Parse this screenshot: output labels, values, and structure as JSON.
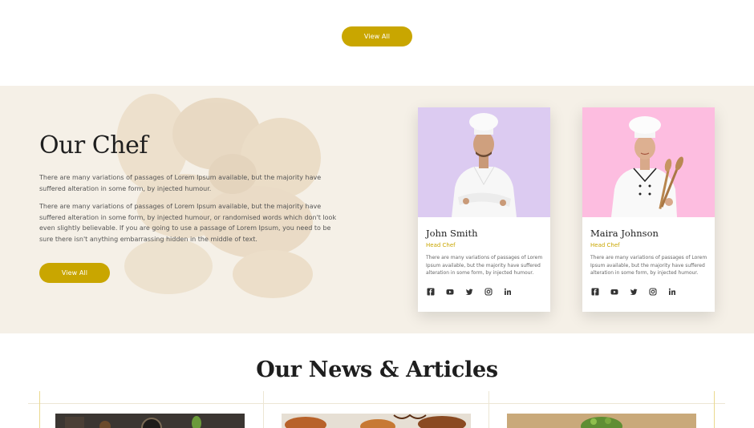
{
  "top": {
    "view_all_label": "View All"
  },
  "chef_section": {
    "title": "Our Chef",
    "paragraph_1": "There are many variations of passages of Lorem Ipsum available, but the majority have suffered alteration in some form, by injected humour.",
    "paragraph_2": "There are many variations of passages of Lorem Ipsum available, but the majority have suffered alteration in some form, by injected humour, or randomised words which don't look even slightly believable. If you are going to use a passage of Lorem Ipsum, you need to be sure there isn't anything embarrassing hidden in the middle of text.",
    "view_all_label": "View All",
    "chefs": [
      {
        "name": "John Smith",
        "role": "Head Chef",
        "description": "There are many variations of passages of Lorem Ipsum available, but the majority have suffered alteration in some form, by injected humour.",
        "photo_background": "#dccbf1",
        "socials": [
          "facebook-icon",
          "youtube-icon",
          "twitter-icon",
          "instagram-icon",
          "linkedin-icon"
        ]
      },
      {
        "name": "Maira Johnson",
        "role": "Head Chef",
        "description": "There are many variations of passages of Lorem Ipsum available, but the majority have suffered alteration in some form, by injected humour.",
        "photo_background": "#fdbde0",
        "socials": [
          "facebook-icon",
          "youtube-icon",
          "twitter-icon",
          "instagram-icon",
          "linkedin-icon"
        ]
      }
    ]
  },
  "news_section": {
    "title": "Our News & Articles"
  },
  "colors": {
    "accent": "#c9a600",
    "section_background": "#f5f0e7",
    "heading": "#1e1e1e"
  }
}
